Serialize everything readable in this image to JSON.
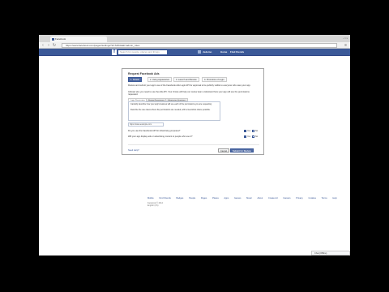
{
  "browser": {
    "tab_title": "Facebook",
    "url": "https://www.facebook.com/pages/settings?id=SDK&tab=admin_roles",
    "window_controls": "- □ x"
  },
  "fb": {
    "logo": "f",
    "search_placeholder": "Search for people, places and things",
    "user": "Jsdemo",
    "nav": [
      "Home",
      "Find friends"
    ]
  },
  "dialog": {
    "title": "Request Facebook Ads",
    "tabs": [
      "1. Details",
      "2. Using Appearance",
      "3. Launch and Review",
      "4. Promotion of Login"
    ],
    "intro": "Review and submit your app's use of the Facebook Ads Login API for approval to be publicly visible to everyone who uses your app.",
    "detail1": "Indicate why you need to use the Ads API. Your choice will help our review team understand how your app will use the permissions requested.",
    "subtabs": [
      "Login Permissions",
      "Review Permissions",
      "Submission Questions"
    ],
    "para1": "Carefully describe how your app's features will use each of the permissions you are requesting.",
    "para2": "Describe the use cases where the permissions are needed, with screenshots where possible.",
    "input_value": "https://www.example.com",
    "q1": "Do you use the Facebook API for Advertising purposes?",
    "q2": "Will your app display ads or advertising content to people who use it?",
    "yes": "Yes",
    "no": "No",
    "footer_link": "Need Help?",
    "cancel": "Cancel",
    "submit": "Submit for Review"
  },
  "footer": {
    "links": [
      "Mobile",
      "Find Friends",
      "Badges",
      "People",
      "Pages",
      "Places",
      "Apps",
      "Games",
      "Music",
      "About",
      "Create Ad",
      "Careers",
      "Privacy",
      "Cookies",
      "Terms",
      "Help"
    ],
    "copyright": "Facebook © 2014",
    "language": "English (US)"
  },
  "chat": {
    "label": "Chat (Offline)"
  }
}
